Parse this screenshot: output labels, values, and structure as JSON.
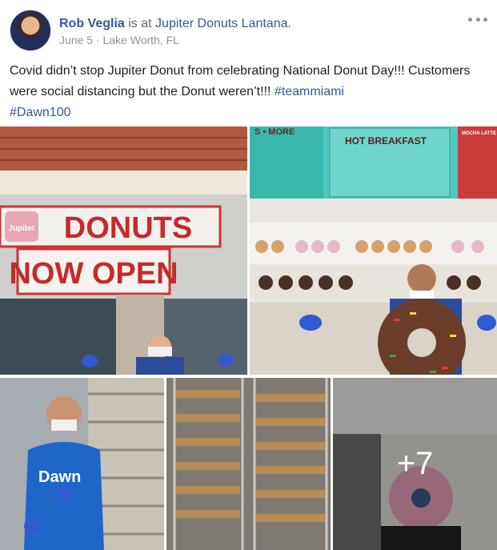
{
  "post": {
    "author": "Rob Veglia",
    "verb": "is at",
    "place": "Jupiter Donuts Lantana.",
    "date": "June 5",
    "separator": "·",
    "location": "Lake Worth, FL",
    "text_before": "Covid didn’t stop Jupiter Donut from celebrating National Donut Day!!! Customers were social distancing but the Donut weren’t!!! ",
    "hashtag1": "#teammiami",
    "hashtag2": "#Dawn100"
  },
  "photos": {
    "p1": {
      "sign_top": "DONUTS",
      "sign_bottom": "NOW OPEN",
      "sign_logo": "Jupiter"
    },
    "p2": {
      "menu_left": "S • MORE",
      "menu_center": "HOT BREAKFAST",
      "menu_right": "MOCHA LATTE"
    },
    "p3": {
      "shirt_text": "Dawn"
    },
    "p5": {
      "more_count": "+7"
    }
  },
  "colors": {
    "link": "#365899",
    "meta": "#90949c",
    "text": "#1c1e21",
    "menu_teal": "#4fc9c0"
  }
}
